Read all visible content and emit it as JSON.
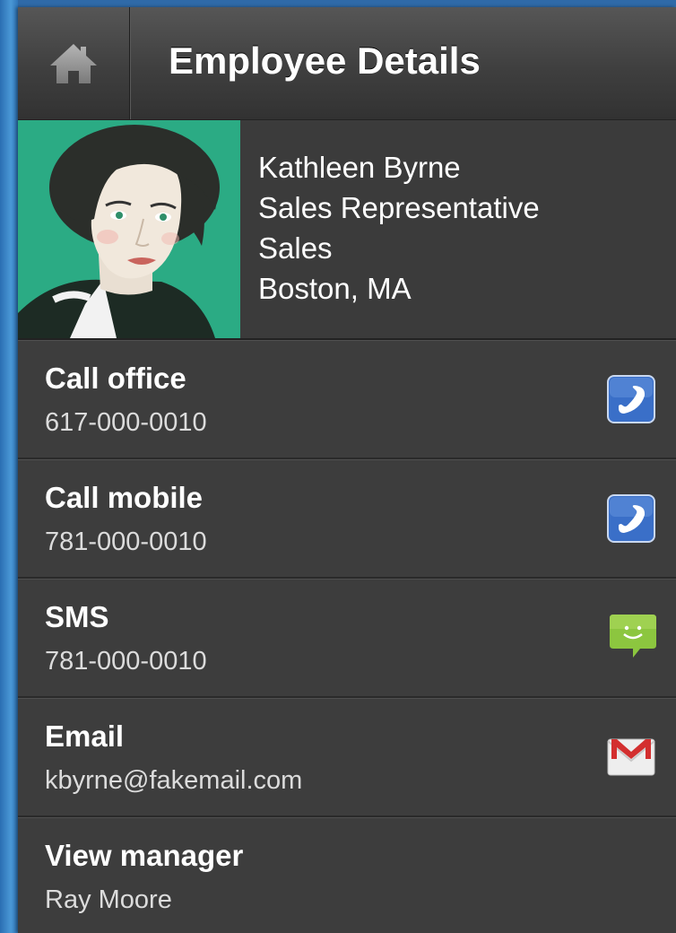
{
  "header": {
    "title": "Employee Details",
    "home_icon": "home-icon"
  },
  "employee": {
    "name": "Kathleen Byrne",
    "title": "Sales Representative",
    "department": "Sales",
    "location": "Boston, MA"
  },
  "actions": [
    {
      "label": "Call office",
      "value": "617-000-0010",
      "icon": "phone-icon"
    },
    {
      "label": "Call mobile",
      "value": "781-000-0010",
      "icon": "phone-icon"
    },
    {
      "label": "SMS",
      "value": "781-000-0010",
      "icon": "sms-icon"
    },
    {
      "label": "Email",
      "value": "kbyrne@fakemail.com",
      "icon": "gmail-icon"
    },
    {
      "label": "View manager",
      "value": "Ray Moore",
      "icon": ""
    }
  ],
  "colors": {
    "avatar_bg": "#2bab84",
    "phone_icon": "#3a6fc8",
    "sms_icon": "#8cc63f",
    "gmail_red": "#d32f2f"
  }
}
